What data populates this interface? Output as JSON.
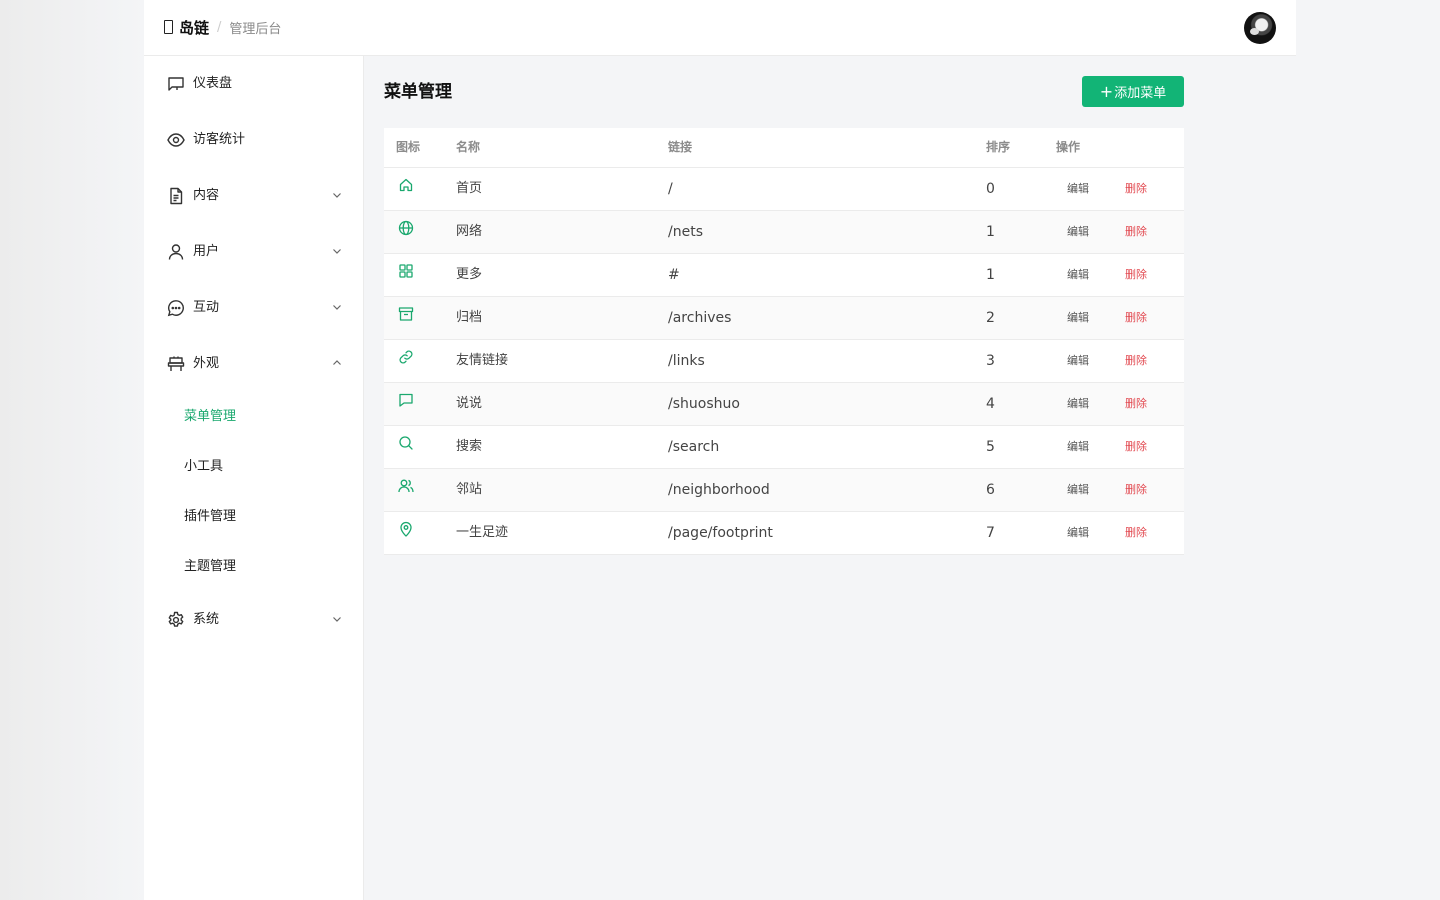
{
  "header": {
    "brand_name": "岛链",
    "separator": "/",
    "brand_sub": "管理后台"
  },
  "sidebar": {
    "items": [
      {
        "label": "仪表盘",
        "icon": "dashboard-icon",
        "expandable": false
      },
      {
        "label": "访客统计",
        "icon": "eye-icon",
        "expandable": false
      },
      {
        "label": "内容",
        "icon": "document-icon",
        "expandable": true,
        "expanded": false
      },
      {
        "label": "用户",
        "icon": "user-icon",
        "expandable": true,
        "expanded": false
      },
      {
        "label": "互动",
        "icon": "chat-icon",
        "expandable": true,
        "expanded": false
      },
      {
        "label": "外观",
        "icon": "appearance-icon",
        "expandable": true,
        "expanded": true
      },
      {
        "label": "系统",
        "icon": "gear-icon",
        "expandable": true,
        "expanded": false
      }
    ],
    "appearance_subitems": [
      {
        "label": "菜单管理",
        "active": true
      },
      {
        "label": "小工具",
        "active": false
      },
      {
        "label": "插件管理",
        "active": false
      },
      {
        "label": "主题管理",
        "active": false
      }
    ]
  },
  "main": {
    "title": "菜单管理",
    "add_button": {
      "plus": "+",
      "label": "添加菜单"
    },
    "table": {
      "headers": {
        "icon": "图标",
        "name": "名称",
        "link": "链接",
        "order": "排序",
        "actions": "操作"
      },
      "edit_label": "编辑",
      "delete_label": "删除",
      "rows": [
        {
          "icon": "home-icon",
          "name": "首页",
          "link": "/",
          "order": "0"
        },
        {
          "icon": "globe-icon",
          "name": "网络",
          "link": "/nets",
          "order": "1"
        },
        {
          "icon": "grid-icon",
          "name": "更多",
          "link": "#",
          "order": "1"
        },
        {
          "icon": "archive-icon",
          "name": "归档",
          "link": "/archives",
          "order": "2"
        },
        {
          "icon": "link-icon",
          "name": "友情链接",
          "link": "/links",
          "order": "3"
        },
        {
          "icon": "message-icon",
          "name": "说说",
          "link": "/shuoshuo",
          "order": "4"
        },
        {
          "icon": "search-icon",
          "name": "搜索",
          "link": "/search",
          "order": "5"
        },
        {
          "icon": "users-icon",
          "name": "邻站",
          "link": "/neighborhood",
          "order": "6"
        },
        {
          "icon": "map-pin-icon",
          "name": "一生足迹",
          "link": "/page/footprint",
          "order": "7"
        }
      ]
    }
  },
  "colors": {
    "accent": "#12b476",
    "active_text": "#1aa86e",
    "delete": "#e2484f",
    "icon_green": "#1aa86e"
  }
}
